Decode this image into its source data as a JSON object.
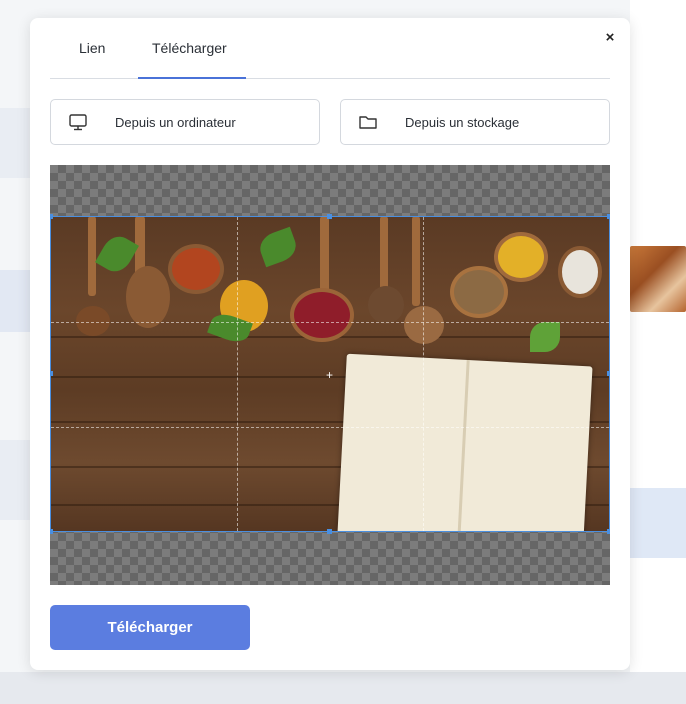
{
  "modal": {
    "tabs": [
      {
        "label": "Lien"
      },
      {
        "label": "Télécharger"
      }
    ],
    "active_tab": "Télécharger",
    "close_label": "×",
    "sources": {
      "computer": {
        "label": "Depuis un ordinateur",
        "icon": "monitor-icon"
      },
      "storage": {
        "label": "Depuis un stockage",
        "icon": "folder-icon"
      }
    },
    "submit_label": "Télécharger",
    "colors": {
      "accent": "#5b7de0",
      "crop_border": "#4a8fe0",
      "tab_underline": "#4a72d8"
    }
  }
}
